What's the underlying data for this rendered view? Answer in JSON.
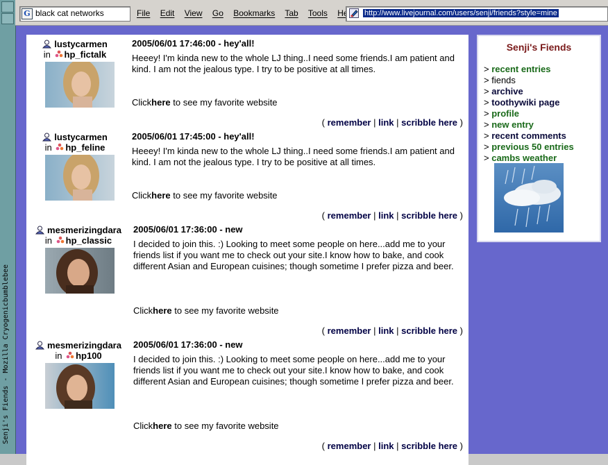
{
  "window": {
    "vertical_title": "Senji's Fiends - Mozilla Cryogenicbumblebee"
  },
  "toolbar": {
    "search_value": "black cat networks",
    "menu": [
      "File",
      "Edit",
      "View",
      "Go",
      "Bookmarks",
      "Tab",
      "Tools",
      "Help"
    ],
    "url": "http://www.livejournal.com/users/senji/friends?style=mine"
  },
  "entries": [
    {
      "user": "lustycarmen",
      "in_label": "in",
      "community": "hp_fictalk",
      "title": "2005/06/01 17:46:00 - hey'all!",
      "body": "Heeey! I'm kinda new to the whole LJ thing..I need some friends.I am patient and kind. I am not the jealous type. I try to be positive at all times.",
      "click_prefix": "Click",
      "click_link": "here",
      "click_suffix": " to see my favorite website",
      "links": {
        "open": "( ",
        "remember": "remember",
        "sep1": " | ",
        "link": "link",
        "sep2": " | ",
        "scribble": "scribble here",
        "close": " )"
      }
    },
    {
      "user": "lustycarmen",
      "in_label": "in",
      "community": "hp_feline",
      "title": "2005/06/01 17:45:00 - hey'all!",
      "body": "Heeey! I'm kinda new to the whole LJ thing..I need some friends.I am patient and kind. I am not the jealous type. I try to be positive at all times.",
      "click_prefix": "Click",
      "click_link": "here",
      "click_suffix": " to see my favorite website",
      "links": {
        "open": "( ",
        "remember": "remember",
        "sep1": " | ",
        "link": "link",
        "sep2": " | ",
        "scribble": "scribble here",
        "close": " )"
      }
    },
    {
      "user": "mesmerizingdara",
      "in_label": "in",
      "community": "hp_classic",
      "title": "2005/06/01 17:36:00 - new",
      "body": "I decided to join this. :) Looking to meet some people on here...add me to your friends list if you want me to check out your site.I know how to bake, and cook different Asian and European cuisines; though sometime I prefer pizza and beer.",
      "click_prefix": "Click",
      "click_link": "here",
      "click_suffix": " to see my favorite website",
      "links": {
        "open": "( ",
        "remember": "remember",
        "sep1": " | ",
        "link": "link",
        "sep2": " | ",
        "scribble": "scribble here",
        "close": " )"
      }
    },
    {
      "user": "mesmerizingdara",
      "in_label": "in",
      "community": "hp100",
      "title": "2005/06/01 17:36:00 - new",
      "body": "I decided to join this. :) Looking to meet some people on here...add me to your friends list if you want me to check out your site.I know how to bake, and cook different Asian and European cuisines; though sometime I prefer pizza and beer.",
      "click_prefix": "Click",
      "click_link": "here",
      "click_suffix": " to see my favorite website",
      "links": {
        "open": "( ",
        "remember": "remember",
        "sep1": " | ",
        "link": "link",
        "sep2": " | ",
        "scribble": "scribble here",
        "close": " )"
      }
    }
  ],
  "sidebar": {
    "title": "Senji's Fiends",
    "marker": ">",
    "items": [
      {
        "label": "recent entries",
        "style": "green"
      },
      {
        "label": "fiends",
        "style": "plain"
      },
      {
        "label": "archive",
        "style": "dark"
      },
      {
        "label": "toothywiki page",
        "style": "dark"
      },
      {
        "label": "profile",
        "style": "green"
      },
      {
        "label": "new entry",
        "style": "green"
      },
      {
        "label": "recent comments",
        "style": "dark"
      },
      {
        "label": "previous 50 entries",
        "style": "green"
      },
      {
        "label": "cambs weather",
        "style": "green"
      }
    ]
  }
}
